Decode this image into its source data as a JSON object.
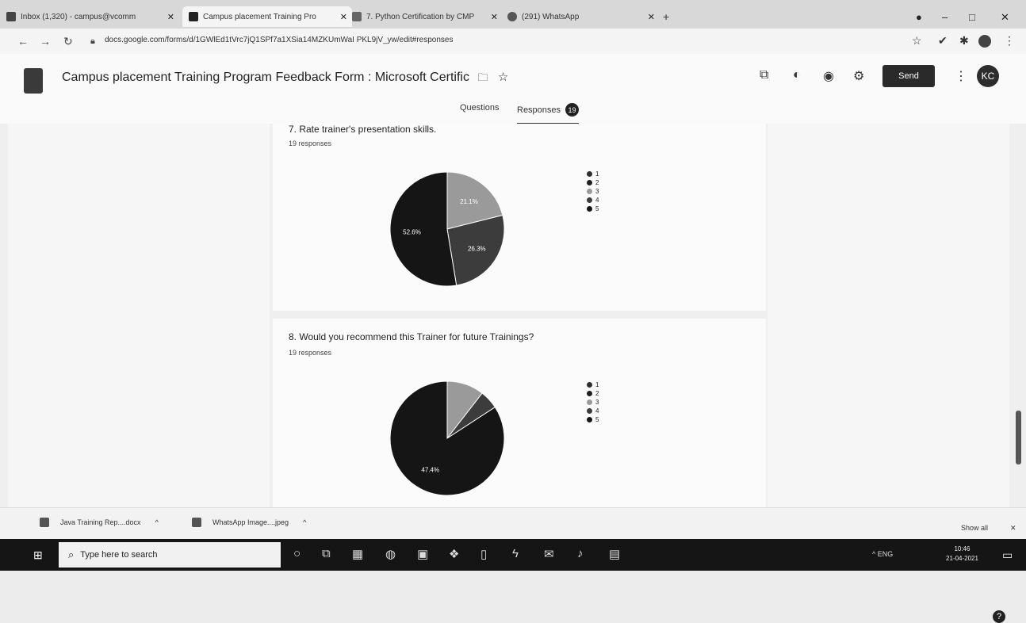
{
  "browser": {
    "tabs": [
      {
        "label": "Inbox (1,320) - campus@vcomm",
        "active": false
      },
      {
        "label": "Campus placement Training Pro",
        "active": true
      },
      {
        "label": "7. Python Certification by CMP",
        "active": false
      },
      {
        "label": "(291) WhatsApp",
        "active": false
      }
    ],
    "new_tab": "+",
    "url": "docs.google.com/forms/d/1GWlEd1tVrc7jQ1SPf7a1XSia14MZKUmWaI PKL9jV_yw/edit#responses",
    "window_controls": {
      "minimize": "–",
      "maximize": "□",
      "close": "✕"
    }
  },
  "form": {
    "title": "Campus placement Training Program  Feedback Form : Microsoft Certific",
    "send_label": "Send",
    "avatar_initials": "KC",
    "tabs": {
      "questions": "Questions",
      "responses": "Responses",
      "responses_count": "19"
    }
  },
  "questions": [
    {
      "title": "7. Rate trainer's presentation skills.",
      "responses": "19 responses",
      "legend": [
        "1",
        "2",
        "3",
        "4",
        "5"
      ],
      "chart_data": {
        "type": "pie",
        "categories": [
          "1",
          "2",
          "3",
          "4",
          "5"
        ],
        "values": [
          0,
          0,
          21.1,
          26.3,
          52.6
        ],
        "slice_labels": [
          "",
          "",
          "21.1%",
          "26.3%",
          "52.6%"
        ],
        "colors": [
          "#2e2e2e",
          "#1f1f1f",
          "#9a9a9a",
          "#3c3c3c",
          "#151515"
        ]
      }
    },
    {
      "title": "8. Would you recommend this Trainer for future Trainings?",
      "responses": "19 responses",
      "legend": [
        "1",
        "2",
        "3",
        "4",
        "5"
      ],
      "chart_data": {
        "type": "pie",
        "categories": [
          "1",
          "2",
          "3",
          "4",
          "5"
        ],
        "values": [
          0,
          0,
          10.5,
          5.3,
          84.2
        ],
        "slice_labels": [
          "",
          "",
          "",
          "",
          "47.4%"
        ],
        "colors": [
          "#2e2e2e",
          "#1f1f1f",
          "#9a9a9a",
          "#3c3c3c",
          "#151515"
        ]
      }
    }
  ],
  "downloads": {
    "items": [
      "Java Training Rep....docx",
      "WhatsApp Image....jpeg"
    ],
    "show_all": "Show all",
    "close": "✕"
  },
  "taskbar": {
    "search_placeholder": "Type here to search",
    "tray": "^  ENG",
    "time": "10:46",
    "date": "21-04-2021"
  }
}
